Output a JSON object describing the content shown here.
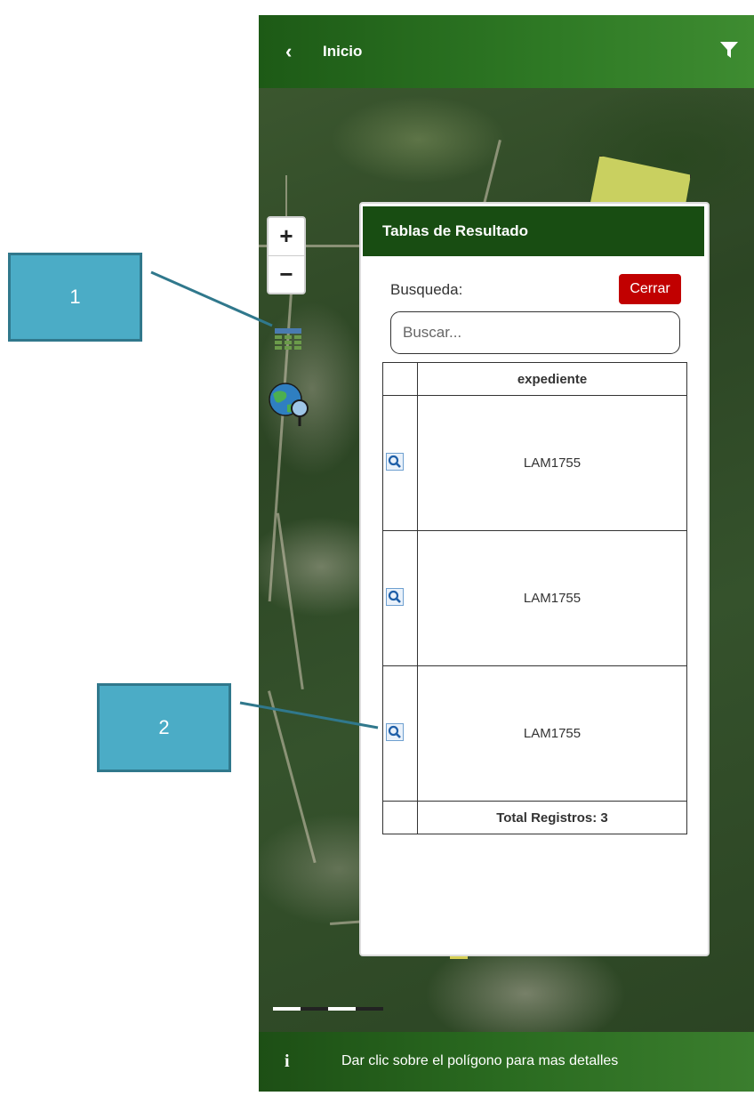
{
  "header": {
    "back_icon": "chevron-left-icon",
    "title": "Inicio",
    "filter_icon": "filter-icon"
  },
  "map": {
    "zoom_in_label": "+",
    "zoom_out_label": "−",
    "tools": [
      "table-grid-icon",
      "globe-search-icon"
    ]
  },
  "panel": {
    "title": "Tablas de Resultado",
    "search_label": "Busqueda:",
    "close_label": "Cerrar",
    "search_placeholder": "Buscar...",
    "table": {
      "columns": [
        "",
        "expediente"
      ],
      "rows": [
        {
          "icon": "search-icon",
          "expediente": "LAM1755"
        },
        {
          "icon": "search-icon",
          "expediente": "LAM1755"
        },
        {
          "icon": "search-icon",
          "expediente": "LAM1755"
        }
      ],
      "footer": "Total Registros: 3"
    }
  },
  "bottom_bar": {
    "info_icon": "info-icon",
    "text": "Dar clic sobre el polígono para mas detalles"
  },
  "callouts": [
    {
      "label": "1"
    },
    {
      "label": "2"
    }
  ],
  "colors": {
    "header_green": "#1d5a16",
    "panel_header_green": "#184d12",
    "close_red": "#c10000",
    "callout_blue": "#4bacc6",
    "callout_border": "#30788c",
    "polygon_yellow": "#c9d060"
  }
}
